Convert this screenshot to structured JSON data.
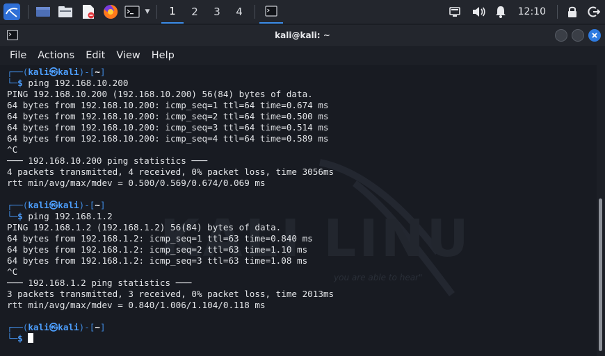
{
  "panel": {
    "workspaces": [
      "1",
      "2",
      "3",
      "4"
    ],
    "active_workspace": "1",
    "clock": "12:10",
    "icons": [
      "kali-menu-icon",
      "desktop-icon",
      "file-manager-icon",
      "text-editor-icon",
      "firefox-icon",
      "terminal-icon",
      "terminal-task-icon",
      "network-icon",
      "volume-icon",
      "notification-icon",
      "lock-icon",
      "logout-icon"
    ]
  },
  "window": {
    "title": "kali@kali: ~",
    "menu": [
      "File",
      "Actions",
      "Edit",
      "View",
      "Help"
    ]
  },
  "terminal": {
    "watermark": {
      "title": "KALI LINUX",
      "tagline": "you are able to hear\""
    },
    "lines": [
      {
        "type": "prompt_top",
        "user": "kali",
        "at": "㉿",
        "host": "kali",
        "dir": "~"
      },
      {
        "type": "prompt_cmd",
        "cmd": "ping 192.168.10.200"
      },
      {
        "type": "out",
        "text": "PING 192.168.10.200 (192.168.10.200) 56(84) bytes of data."
      },
      {
        "type": "out",
        "text": "64 bytes from 192.168.10.200: icmp_seq=1 ttl=64 time=0.674 ms"
      },
      {
        "type": "out",
        "text": "64 bytes from 192.168.10.200: icmp_seq=2 ttl=64 time=0.500 ms"
      },
      {
        "type": "out",
        "text": "64 bytes from 192.168.10.200: icmp_seq=3 ttl=64 time=0.514 ms"
      },
      {
        "type": "out",
        "text": "64 bytes from 192.168.10.200: icmp_seq=4 ttl=64 time=0.589 ms"
      },
      {
        "type": "out",
        "text": "^C"
      },
      {
        "type": "out",
        "text": "─── 192.168.10.200 ping statistics ───"
      },
      {
        "type": "out",
        "text": "4 packets transmitted, 4 received, 0% packet loss, time 3056ms"
      },
      {
        "type": "out",
        "text": "rtt min/avg/max/mdev = 0.500/0.569/0.674/0.069 ms"
      },
      {
        "type": "out",
        "text": ""
      },
      {
        "type": "prompt_top",
        "user": "kali",
        "at": "㉿",
        "host": "kali",
        "dir": "~"
      },
      {
        "type": "prompt_cmd",
        "cmd": "ping 192.168.1.2"
      },
      {
        "type": "out",
        "text": "PING 192.168.1.2 (192.168.1.2) 56(84) bytes of data."
      },
      {
        "type": "out",
        "text": "64 bytes from 192.168.1.2: icmp_seq=1 ttl=63 time=0.840 ms"
      },
      {
        "type": "out",
        "text": "64 bytes from 192.168.1.2: icmp_seq=2 ttl=63 time=1.10 ms"
      },
      {
        "type": "out",
        "text": "64 bytes from 192.168.1.2: icmp_seq=3 ttl=63 time=1.08 ms"
      },
      {
        "type": "out",
        "text": "^C"
      },
      {
        "type": "out",
        "text": "─── 192.168.1.2 ping statistics ───"
      },
      {
        "type": "out",
        "text": "3 packets transmitted, 3 received, 0% packet loss, time 2013ms"
      },
      {
        "type": "out",
        "text": "rtt min/avg/max/mdev = 0.840/1.006/1.104/0.118 ms"
      },
      {
        "type": "out",
        "text": ""
      },
      {
        "type": "prompt_top",
        "user": "kali",
        "at": "㉿",
        "host": "kali",
        "dir": "~"
      },
      {
        "type": "prompt_cursor",
        "cmd": ""
      }
    ]
  },
  "colors": {
    "prompt_frame": "#3f8ae0",
    "prompt_user": "#4d9fff",
    "accent": "#3b8ce8",
    "background": "#181b22"
  }
}
